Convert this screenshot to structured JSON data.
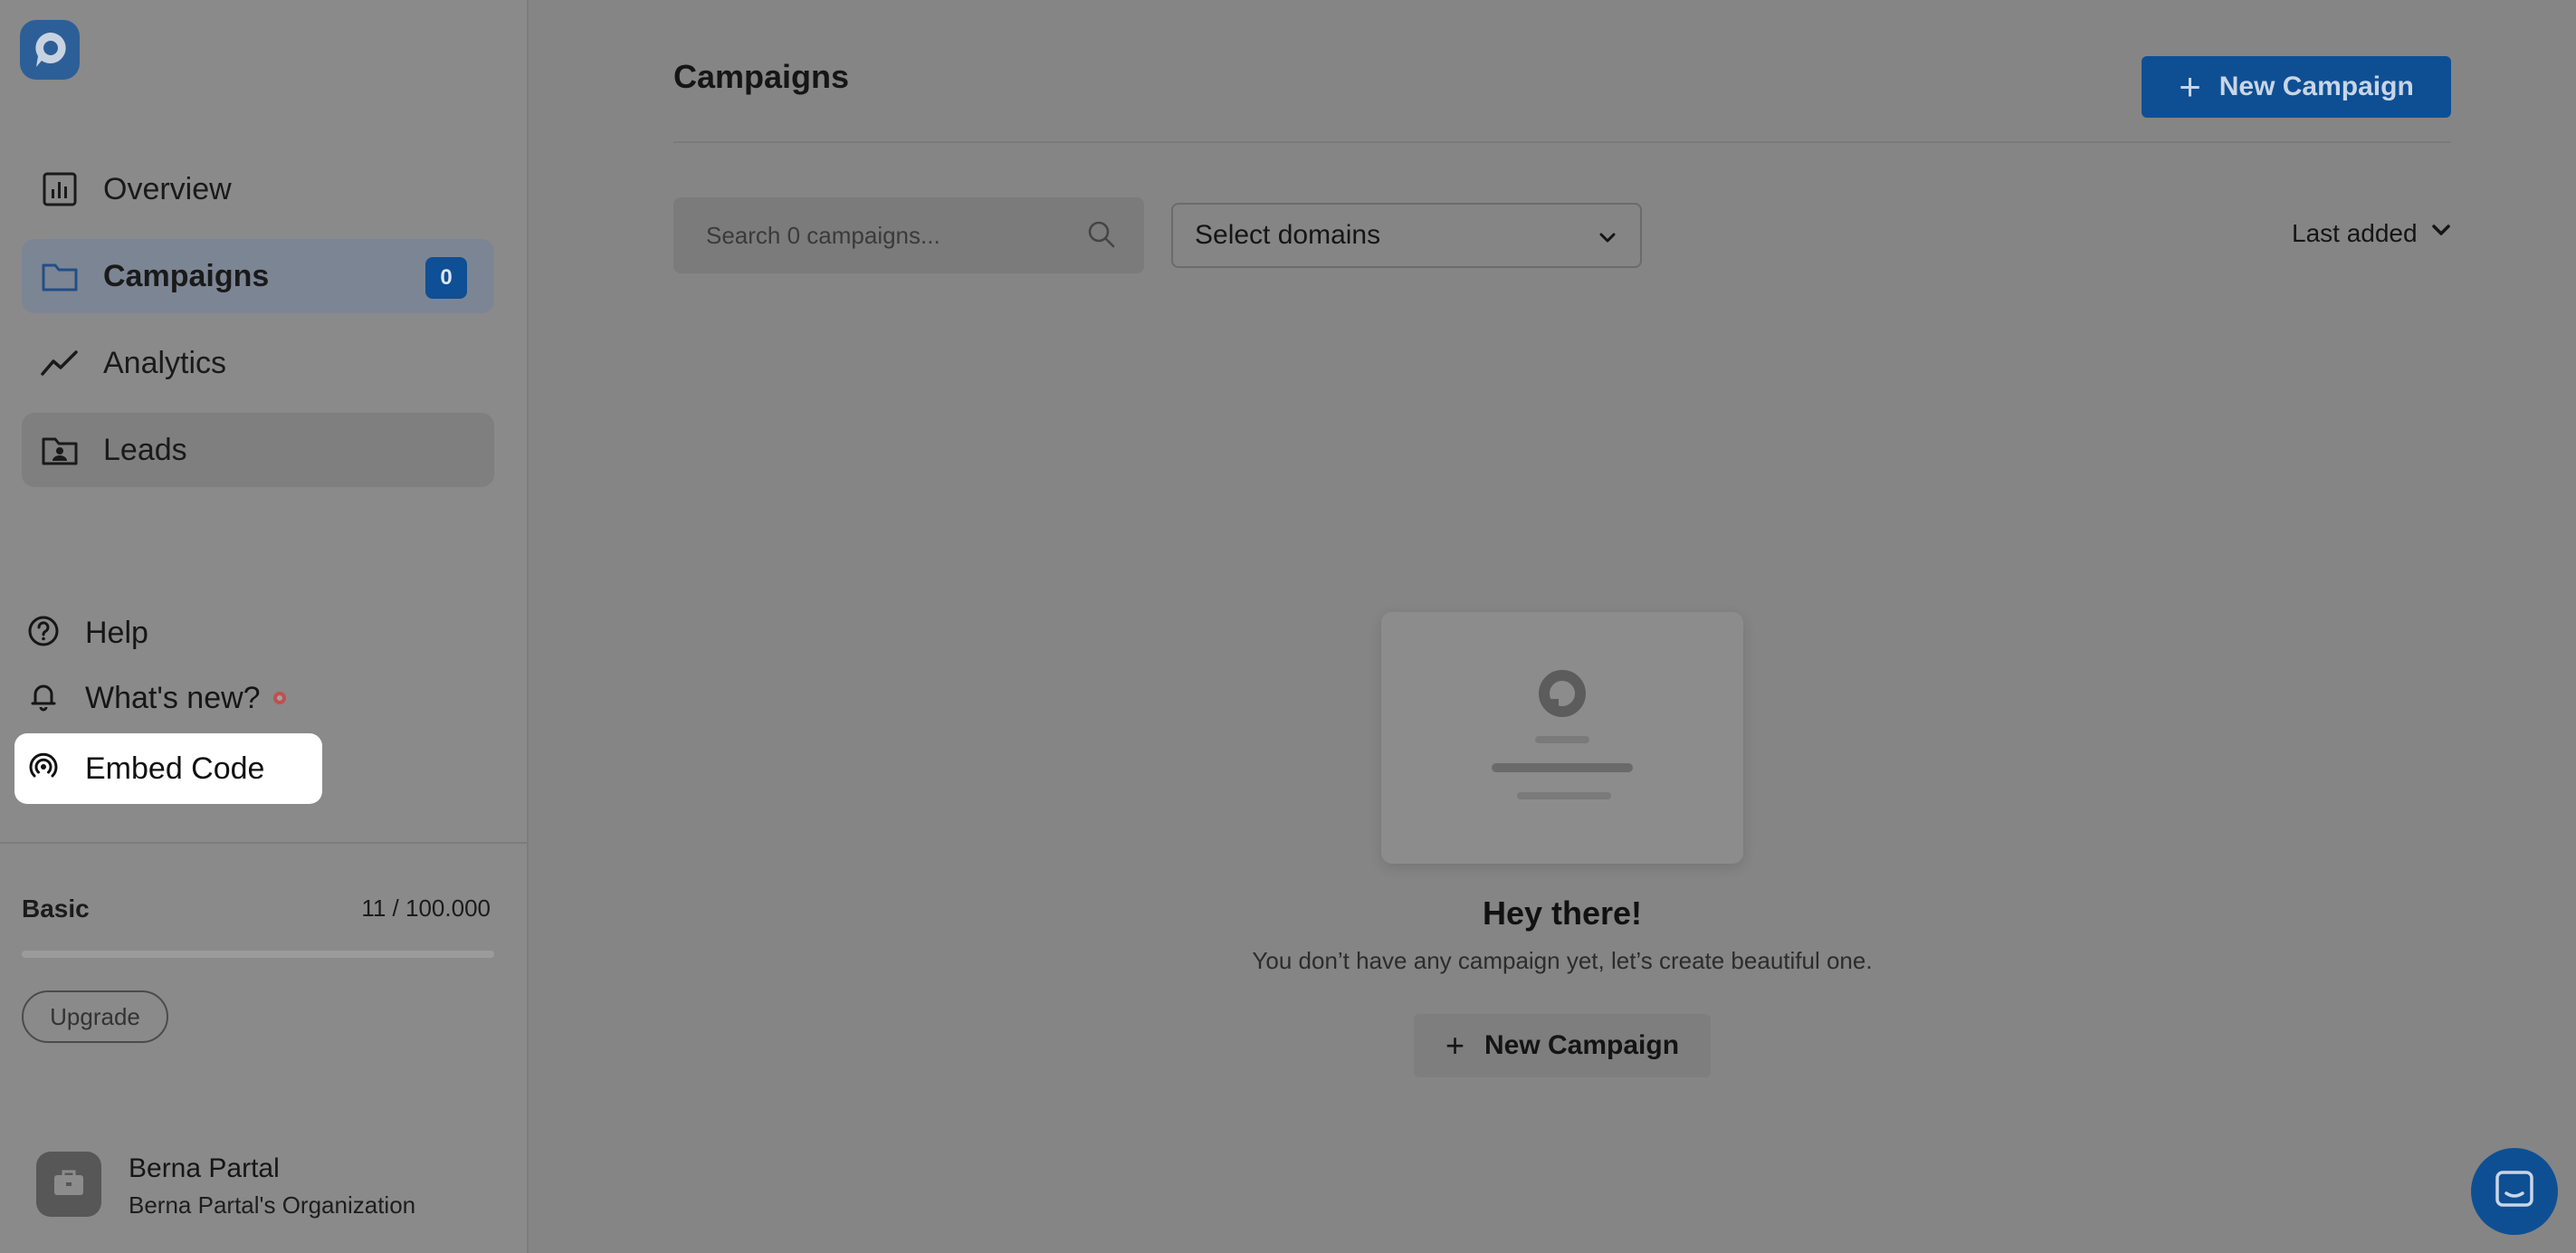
{
  "sidebar": {
    "nav": [
      {
        "label": "Overview",
        "icon": "chart-icon"
      },
      {
        "label": "Campaigns",
        "icon": "folder-icon",
        "badge": "0",
        "active": true
      },
      {
        "label": "Analytics",
        "icon": "trend-icon"
      },
      {
        "label": "Leads",
        "icon": "contact-folder-icon"
      }
    ],
    "utility": [
      {
        "label": "Help",
        "icon": "help-icon"
      },
      {
        "label": "What's new?",
        "icon": "bell-icon"
      },
      {
        "label": "Embed Code",
        "icon": "embed-icon"
      }
    ],
    "plan": {
      "name": "Basic",
      "usage": "11 / 100.000",
      "usage_fraction": 0.00011,
      "upgrade_label": "Upgrade"
    },
    "user": {
      "name": "Berna Partal",
      "org": "Berna Partal's Organization"
    }
  },
  "main": {
    "title": "Campaigns",
    "new_campaign_label": "New Campaign",
    "search": {
      "placeholder": "Search 0 campaigns..."
    },
    "domain_select": {
      "value": "Select domains"
    },
    "sort": {
      "label": "Last added"
    },
    "empty_state": {
      "title": "Hey there!",
      "subtitle": "You don’t have any campaign yet, let’s create beautiful one.",
      "button_label": "New Campaign"
    }
  },
  "colors": {
    "accent": "#0e4f94",
    "overlay": "#858585",
    "notification_dot": "#c0504f"
  }
}
